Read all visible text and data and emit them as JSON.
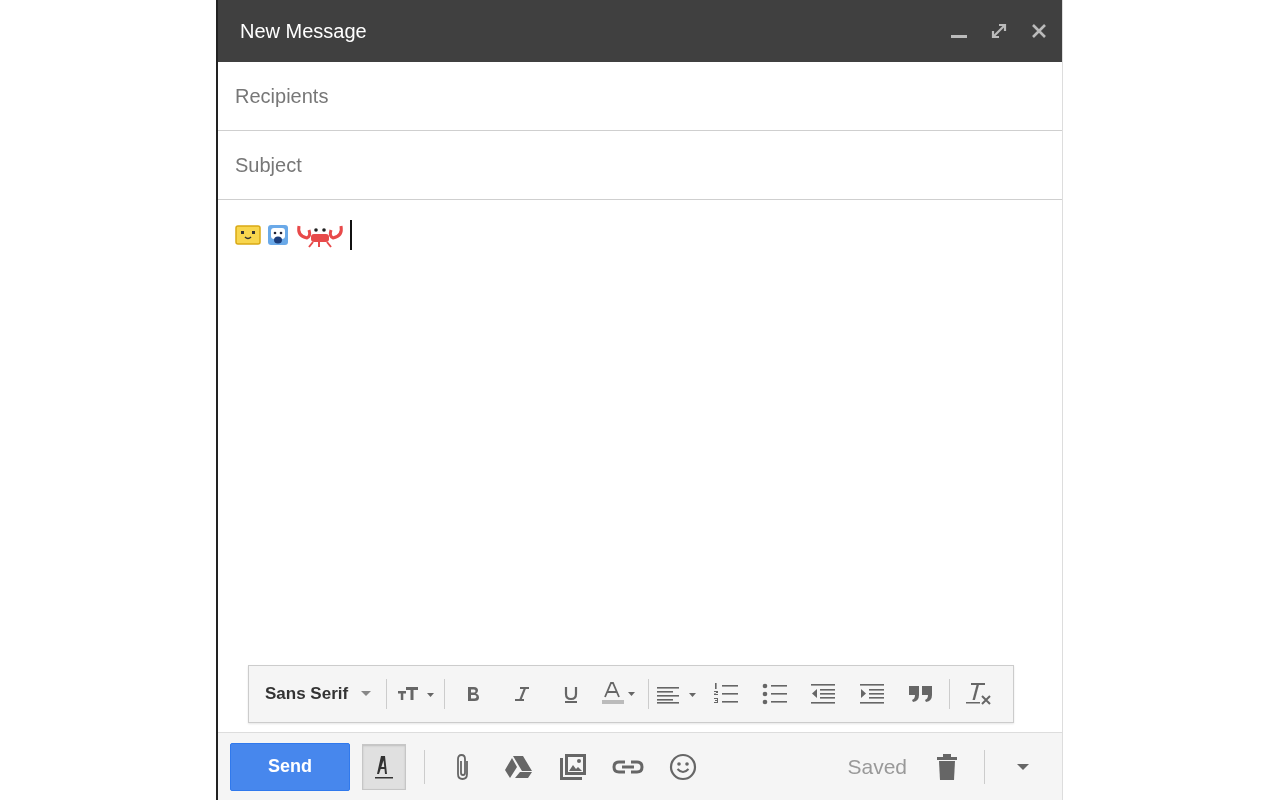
{
  "window": {
    "title": "New Message",
    "controls": [
      {
        "kind": "minimize"
      },
      {
        "kind": "expand"
      },
      {
        "kind": "close"
      }
    ]
  },
  "recipients": {
    "placeholder": "Recipients"
  },
  "subject": {
    "placeholder": "Subject"
  },
  "body": {
    "emojis": [
      {
        "kind": "smiley"
      },
      {
        "kind": "bear"
      },
      {
        "kind": "crab"
      }
    ]
  },
  "format_bar": {
    "font": "Sans Serif",
    "tools": [
      {
        "kind": "divider"
      },
      {
        "kind": "size"
      },
      {
        "kind": "divider"
      },
      {
        "kind": "bold"
      },
      {
        "kind": "italic"
      },
      {
        "kind": "underline"
      },
      {
        "kind": "color"
      },
      {
        "kind": "divider"
      },
      {
        "kind": "align"
      },
      {
        "kind": "numbered"
      },
      {
        "kind": "bulleted"
      },
      {
        "kind": "outdent"
      },
      {
        "kind": "indent"
      },
      {
        "kind": "quote"
      },
      {
        "kind": "divider"
      },
      {
        "kind": "clear"
      }
    ]
  },
  "bottom_bar": {
    "send": "Send",
    "formatting_toggle": {
      "selected": true
    },
    "tools": [
      {
        "kind": "divider"
      },
      {
        "kind": "attach"
      },
      {
        "kind": "drive"
      },
      {
        "kind": "photo"
      },
      {
        "kind": "link"
      },
      {
        "kind": "emoji"
      }
    ],
    "status": "Saved",
    "actions": [
      {
        "kind": "trash"
      },
      {
        "kind": "divider"
      },
      {
        "kind": "more"
      }
    ]
  }
}
